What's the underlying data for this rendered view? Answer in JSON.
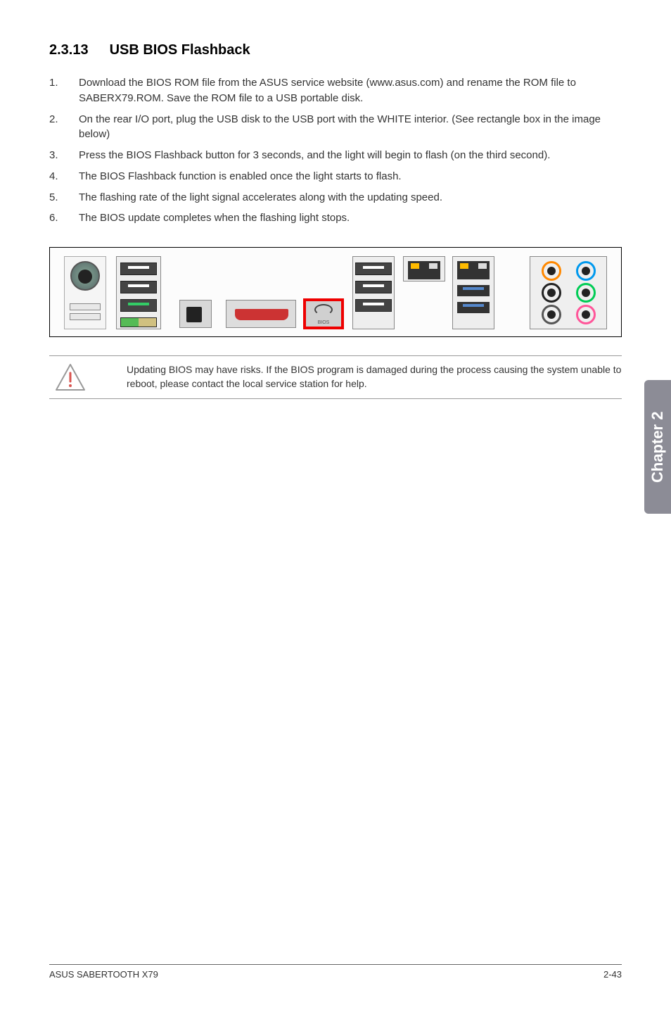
{
  "heading": {
    "number": "2.3.13",
    "title": "USB BIOS Flashback"
  },
  "instructions": [
    {
      "num": "1.",
      "text": "Download the BIOS ROM file from the ASUS service website (www.asus.com) and rename the ROM file to SABERX79.ROM. Save the ROM file to a USB portable disk."
    },
    {
      "num": "2.",
      "text": "On the rear I/O port, plug the USB disk to the USB port with the WHITE interior. (See rectangle box in the image below)"
    },
    {
      "num": "3.",
      "text": "Press the BIOS Flashback button for 3 seconds, and the light will begin to flash (on the third second)."
    },
    {
      "num": "4.",
      "text": "The BIOS Flashback function is enabled once the light starts to flash."
    },
    {
      "num": "5.",
      "text": "The flashing rate of the light signal accelerates along with the updating speed."
    },
    {
      "num": "6.",
      "text": "The BIOS update completes when the flashing light stops."
    }
  ],
  "note": "Updating BIOS may have risks. If the BIOS program is damaged during the process causing the system unable to reboot, please contact the local service station for help.",
  "tab": "Chapter 2",
  "footer": {
    "left": "ASUS SABERTOOTH X79",
    "right": "2-43"
  },
  "io_panel_label": "BIOS"
}
